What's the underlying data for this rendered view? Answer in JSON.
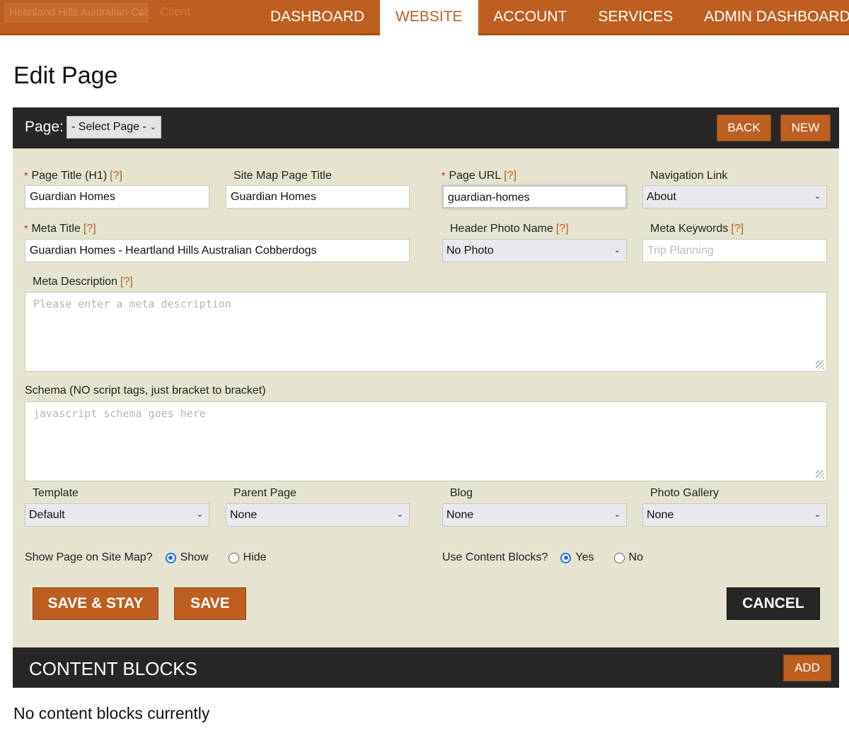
{
  "topbar": {
    "site_select": "Heartland Hills Australian Cobberdogs",
    "client_label": "Client",
    "nav": [
      {
        "label": "DASHBOARD",
        "active": false
      },
      {
        "label": "WEBSITE",
        "active": true
      },
      {
        "label": "ACCOUNT",
        "active": false
      },
      {
        "label": "SERVICES",
        "active": false
      },
      {
        "label": "ADMIN DASHBOARD",
        "active": false
      }
    ]
  },
  "page_title": "Edit Page",
  "panel": {
    "page_label": "Page:",
    "page_select": "- Select Page -",
    "back_label": "BACK",
    "new_label": "NEW"
  },
  "form": {
    "help_mark": "[?]",
    "page_title_h1": {
      "label": "Page Title (H1)",
      "value": "Guardian Homes"
    },
    "site_map_title": {
      "label": "Site Map Page Title",
      "value": "Guardian Homes"
    },
    "page_url": {
      "label": "Page URL",
      "value": "guardian-homes"
    },
    "navigation_link": {
      "label": "Navigation Link",
      "value": "About"
    },
    "meta_title": {
      "label": "Meta Title",
      "value": "Guardian Homes - Heartland Hills Australian Cobberdogs"
    },
    "header_photo": {
      "label": "Header Photo Name",
      "value": "No Photo"
    },
    "meta_keywords": {
      "label": "Meta Keywords",
      "placeholder": "Trip Planning"
    },
    "meta_description": {
      "label": "Meta Description",
      "placeholder": "Please enter a meta description"
    },
    "schema": {
      "label": "Schema (NO script tags, just bracket to bracket)",
      "placeholder": "javascript schema goes here"
    },
    "template": {
      "label": "Template",
      "value": "Default"
    },
    "parent_page": {
      "label": "Parent Page",
      "value": "None"
    },
    "blog": {
      "label": "Blog",
      "value": "None"
    },
    "photo_gallery": {
      "label": "Photo Gallery",
      "value": "None"
    },
    "show_on_sitemap": {
      "label": "Show Page on Site Map?",
      "options": [
        "Show",
        "Hide"
      ],
      "selected": "Show"
    },
    "use_content_blocks": {
      "label": "Use Content Blocks?",
      "options": [
        "Yes",
        "No"
      ],
      "selected": "Yes"
    },
    "save_stay_label": "SAVE & STAY",
    "save_label": "SAVE",
    "cancel_label": "CANCEL"
  },
  "content_blocks": {
    "title": "CONTENT BLOCKS",
    "add_label": "ADD",
    "empty_message": "No content blocks currently"
  },
  "colors": {
    "accent": "#bd5f20",
    "dark": "#262626",
    "form_bg": "#e5e4d0",
    "radio_checked": "#1a73e8"
  }
}
